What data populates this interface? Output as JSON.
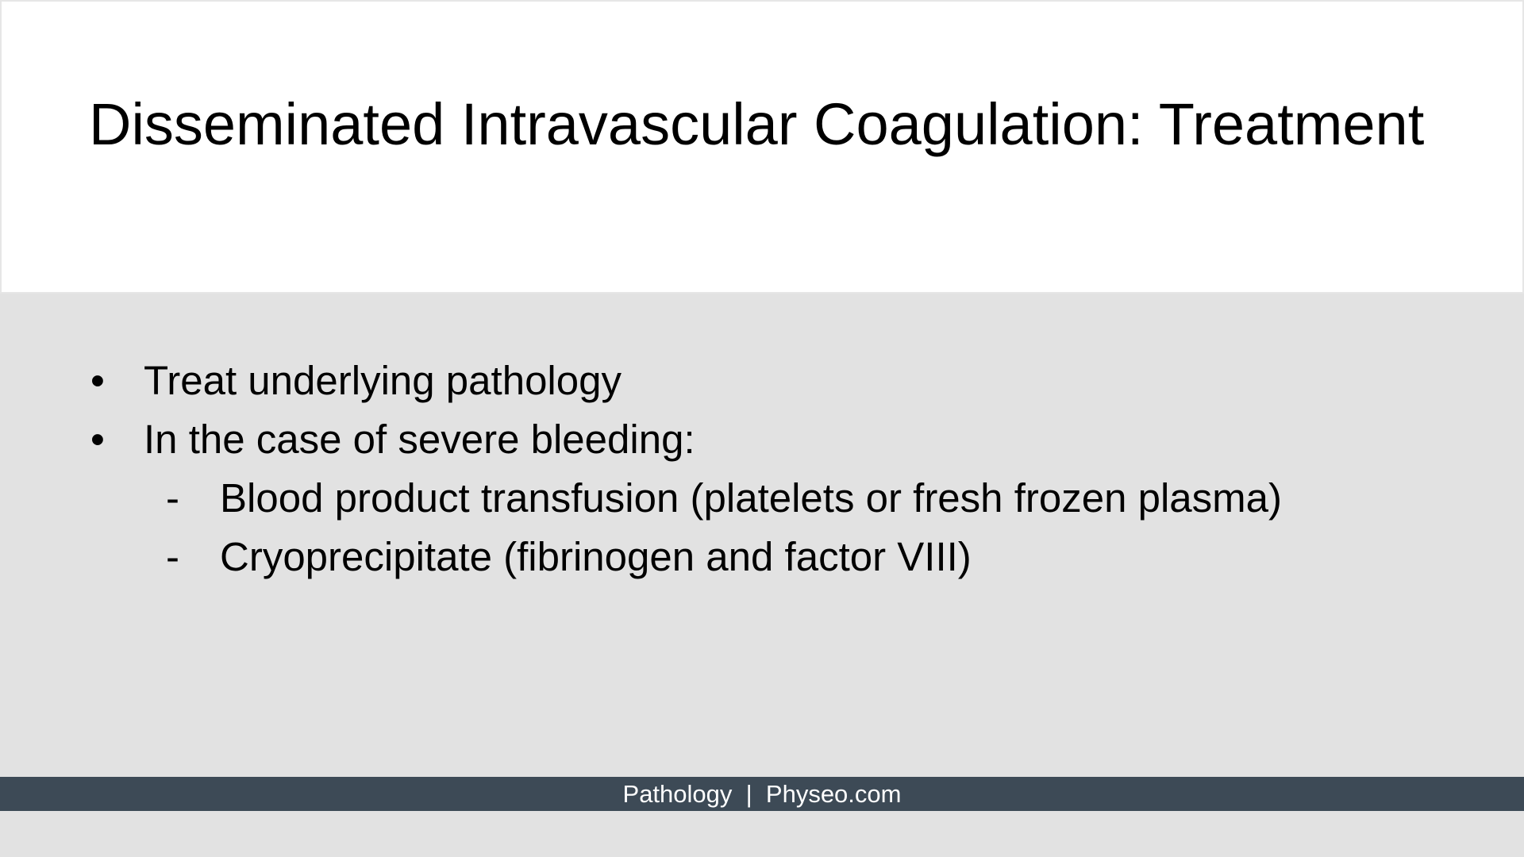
{
  "slide": {
    "title": "Disseminated Intravascular Coagulation: Treatment",
    "bullets": [
      {
        "marker": "•",
        "text": "Treat underlying pathology"
      },
      {
        "marker": "•",
        "text": "In the case of severe bleeding:"
      },
      {
        "marker": "-",
        "text": "Blood product transfusion (platelets or fresh frozen plasma)"
      },
      {
        "marker": "-",
        "text": "Cryoprecipitate (fibrinogen and factor VIII)"
      }
    ],
    "footer": "Pathology  |  Physeo.com"
  },
  "colors": {
    "background": "#e2e2e2",
    "title_background": "#ffffff",
    "footer_background": "#3d4a56",
    "footer_text": "#ffffff"
  }
}
